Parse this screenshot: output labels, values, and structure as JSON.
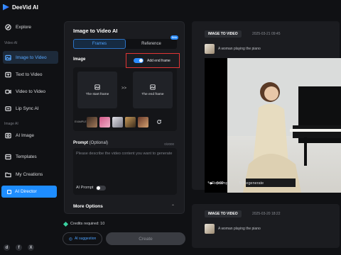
{
  "brand": {
    "name": "DeeVid AI"
  },
  "nav": {
    "explore": "Explore",
    "section_video": "Video AI",
    "image_to_video": "Image to Video",
    "text_to_video": "Text to Video",
    "video_to_video": "Video to Video",
    "lip_sync": "Lip Sync AI",
    "section_image": "Image AI",
    "ai_image": "AI Image",
    "templates": "Templates",
    "my_creations": "My Creations",
    "ai_director": "AI Director"
  },
  "socials": [
    "discord-icon",
    "facebook-icon",
    "x-icon"
  ],
  "panel": {
    "title": "Image to Video AI",
    "tabs": [
      "Frames",
      "Reference"
    ],
    "beta": "Beta",
    "image_label": "Image",
    "add_end_frame": "Add end frame",
    "start_frame": "The start frame",
    "end_frame": "The end frame",
    "example_label": "EXAMPLE",
    "prompt_label": "Prompt",
    "prompt_optional": "(Optional)",
    "prompt_count": "0/2000",
    "prompt_placeholder": "Please describe the video content you want to generate",
    "ai_prompt": "AI Prompt",
    "more_options": "More Options"
  },
  "footer": {
    "credits": "Credits required: 10",
    "ai_suggestion": "AI suggestion",
    "create": "Create"
  },
  "results": [
    {
      "tag": "IMAGE TO VIDEO",
      "date": "2025-03-21 09:45",
      "desc": "A woman playing the piano",
      "time": "0:00",
      "reprompt": "Reprompt",
      "regenerate": "Regenerate"
    },
    {
      "tag": "IMAGE TO VIDEO",
      "date": "2025-03-20 18:22",
      "desc": "A woman playing the piano"
    }
  ],
  "colors": {
    "accent": "#1e8dff",
    "highlight": "#e13535",
    "bg": "#101114",
    "panel": "#1b1c20"
  }
}
